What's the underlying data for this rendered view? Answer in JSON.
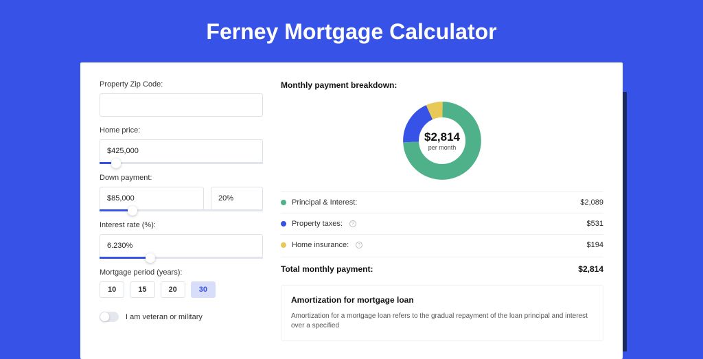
{
  "title": "Ferney Mortgage Calculator",
  "form": {
    "zip_label": "Property Zip Code:",
    "zip_value": "",
    "price_label": "Home price:",
    "price_value": "$425,000",
    "price_slider_pct": "10%",
    "down_label": "Down payment:",
    "down_value": "$85,000",
    "down_pct": "20%",
    "down_slider_pct": "20%",
    "rate_label": "Interest rate (%):",
    "rate_value": "6.230%",
    "rate_slider_pct": "31%",
    "period_label": "Mortgage period (years):",
    "periods": [
      "10",
      "15",
      "20",
      "30"
    ],
    "period_selected": "30",
    "veteran_label": "I am veteran or military"
  },
  "breakdown": {
    "title": "Monthly payment breakdown:",
    "center_amount": "$2,814",
    "center_sub": "per month",
    "items": [
      {
        "label": "Principal & Interest:",
        "value": "$2,089",
        "color": "#4eb18a"
      },
      {
        "label": "Property taxes:",
        "value": "$531",
        "color": "#3652e7",
        "info": true
      },
      {
        "label": "Home insurance:",
        "value": "$194",
        "color": "#e8c856",
        "info": true
      }
    ],
    "total_label": "Total monthly payment:",
    "total_value": "$2,814"
  },
  "chart_data": {
    "type": "pie",
    "title": "Monthly payment breakdown",
    "series": [
      {
        "name": "Principal & Interest",
        "value": 2089,
        "color": "#4eb18a"
      },
      {
        "name": "Property taxes",
        "value": 531,
        "color": "#3652e7"
      },
      {
        "name": "Home insurance",
        "value": 194,
        "color": "#e8c856"
      }
    ],
    "total": 2814,
    "center_label": "$2,814 per month"
  },
  "amort": {
    "title": "Amortization for mortgage loan",
    "text": "Amortization for a mortgage loan refers to the gradual repayment of the loan principal and interest over a specified"
  }
}
